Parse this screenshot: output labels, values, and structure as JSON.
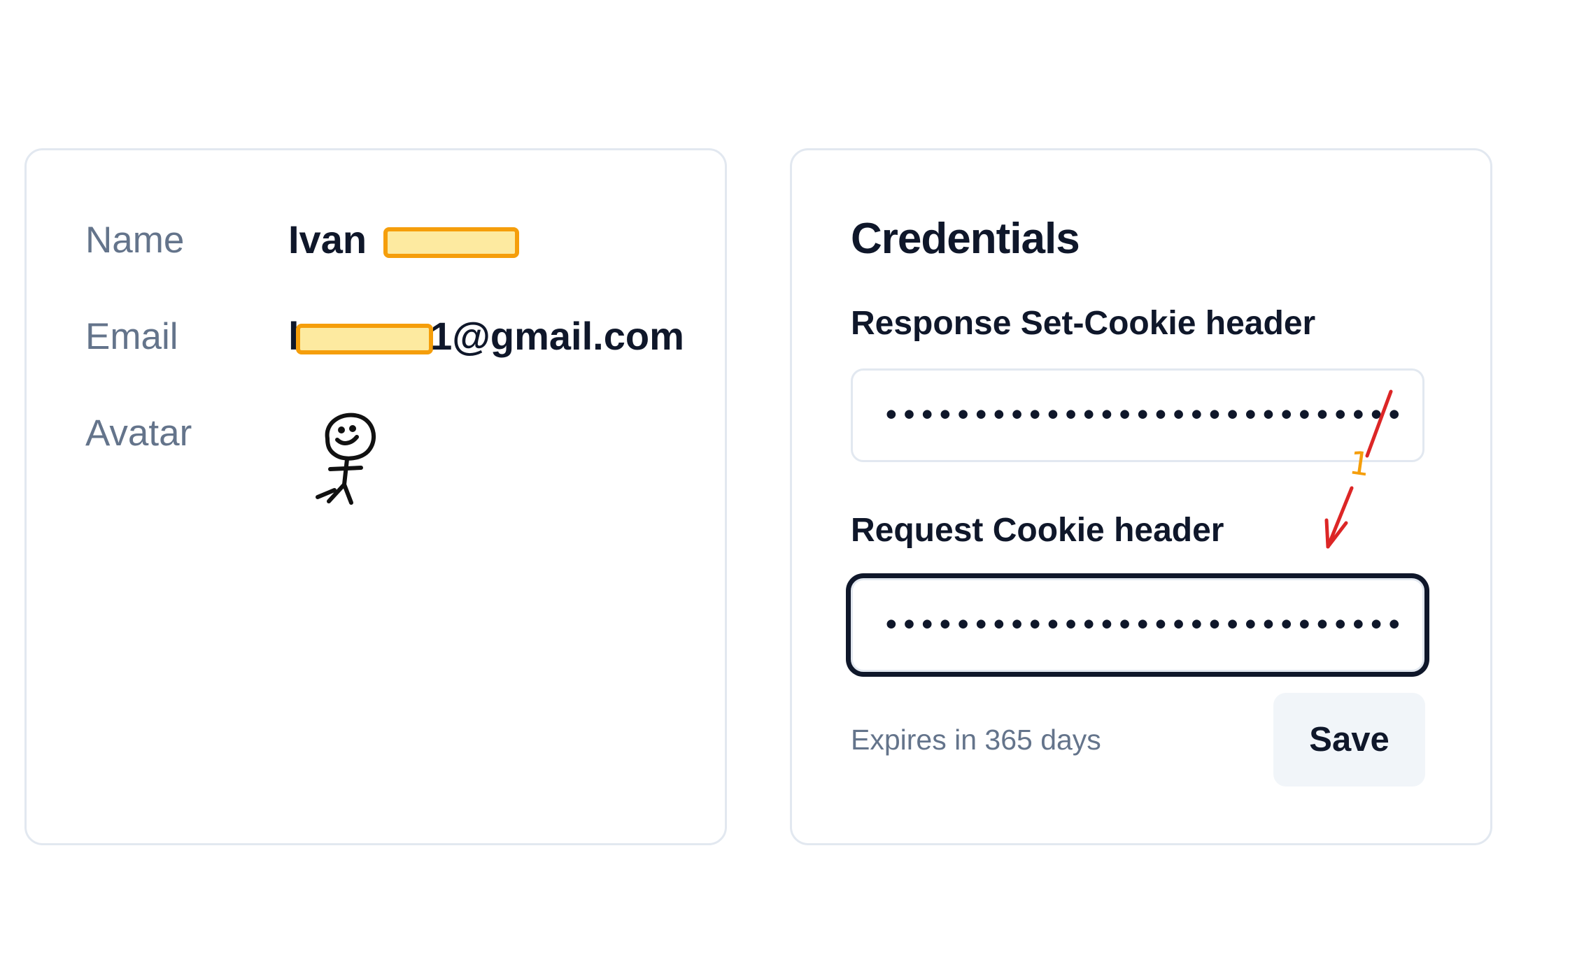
{
  "profile": {
    "name_label": "Name",
    "name_value": "Ivan",
    "email_label": "Email",
    "email_prefix": "k",
    "email_suffix": "1@gmail.com",
    "avatar_label": "Avatar"
  },
  "credentials": {
    "title": "Credentials",
    "response_label": "Response Set-Cookie header",
    "response_value": "••••••••••••••••••••••••••••••••••••",
    "request_label": "Request Cookie header",
    "request_value": "••••••••••••••••••••••••••••••••••••",
    "expires_text": "Expires in 365 days",
    "save_label": "Save"
  },
  "annotation": {
    "step_number": "1",
    "arrow_color": "#dc2626",
    "number_color": "#f59e0b"
  },
  "colors": {
    "redaction_fill": "#fdeaa0",
    "redaction_border": "#f59e0b",
    "focus_ring": "#0f172a"
  }
}
